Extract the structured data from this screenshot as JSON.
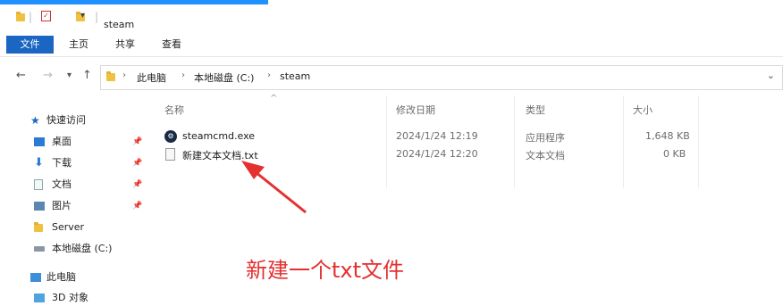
{
  "window": {
    "title": "steam",
    "accent_color": "#1a66c2",
    "top_bar_color": "#1e90ff"
  },
  "ribbon": {
    "tabs": [
      {
        "label": "文件",
        "active": true
      },
      {
        "label": "主页"
      },
      {
        "label": "共享"
      },
      {
        "label": "查看"
      }
    ]
  },
  "address_bar": {
    "breadcrumbs": [
      "此电脑",
      "本地磁盘 (C:)",
      "steam"
    ],
    "separator": "›",
    "dropdown_icon": "chevron-down-icon"
  },
  "sidebar": {
    "items": [
      {
        "label": "快速访问",
        "icon": "star-icon",
        "pinned": false
      },
      {
        "label": "桌面",
        "icon": "desktop-icon",
        "pinned": true
      },
      {
        "label": "下载",
        "icon": "download-icon",
        "pinned": true
      },
      {
        "label": "文档",
        "icon": "document-icon",
        "pinned": true
      },
      {
        "label": "图片",
        "icon": "picture-icon",
        "pinned": true
      },
      {
        "label": "Server",
        "icon": "folder-icon",
        "pinned": false
      },
      {
        "label": "本地磁盘 (C:)",
        "icon": "drive-icon",
        "pinned": false
      },
      {
        "label": "此电脑",
        "icon": "computer-icon",
        "pinned": false
      },
      {
        "label": "3D 对象",
        "icon": "3d-objects-icon",
        "pinned": false
      }
    ]
  },
  "file_list": {
    "columns": [
      "名称",
      "修改日期",
      "类型",
      "大小"
    ],
    "sort_indicator": "^",
    "rows": [
      {
        "name": "steamcmd.exe",
        "modified": "2024/1/24 12:19",
        "type": "应用程序",
        "size": "1,648 KB",
        "icon": "steam-icon"
      },
      {
        "name": "新建文本文档.txt",
        "modified": "2024/1/24 12:20",
        "type": "文本文档",
        "size": "0 KB",
        "icon": "text-file-icon"
      }
    ]
  },
  "annotation": {
    "text": "新建一个txt文件",
    "color": "#e53030"
  }
}
